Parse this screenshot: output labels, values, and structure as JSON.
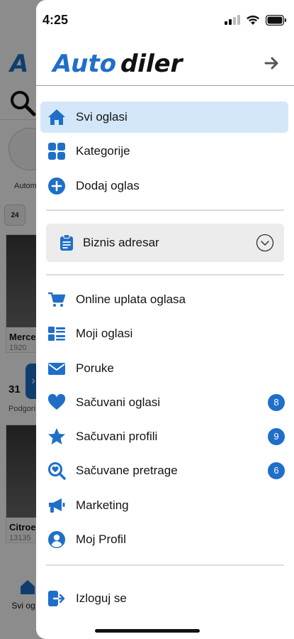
{
  "background": {
    "logo": "A",
    "category_label": "Autom",
    "badge_24": "24",
    "cards": [
      {
        "title": "Merce",
        "sub": "1920",
        "price": "31 ",
        "city": "Podgori"
      },
      {
        "title": "Citroe",
        "sub": "13135"
      }
    ],
    "tab_label": "Svi og"
  },
  "status_bar": {
    "time": "4:25"
  },
  "brand": {
    "logo_part1": "Auto",
    "logo_part2": "diler",
    "accent_color": "#1f6fc8"
  },
  "menu": {
    "primary": [
      {
        "label": "Svi oglasi",
        "icon": "home-icon",
        "active": true
      },
      {
        "label": "Kategorije",
        "icon": "grid-icon"
      },
      {
        "label": "Dodaj oglas",
        "icon": "plus-circle-icon"
      }
    ],
    "biznis_adresar": {
      "label": "Biznis adresar",
      "icon": "clipboard-icon"
    },
    "secondary": [
      {
        "label": "Online uplata oglasa",
        "icon": "cart-icon"
      },
      {
        "label": "Moji oglasi",
        "icon": "list-icon"
      },
      {
        "label": "Poruke",
        "icon": "envelope-icon"
      },
      {
        "label": "Sačuvani oglasi",
        "icon": "heart-icon",
        "badge": "8"
      },
      {
        "label": "Sačuvani profili",
        "icon": "star-icon",
        "badge": "9"
      },
      {
        "label": "Sačuvane pretrage",
        "icon": "search-heart-icon",
        "badge": "6"
      },
      {
        "label": "Marketing",
        "icon": "megaphone-icon"
      },
      {
        "label": "Moj Profil",
        "icon": "user-circle-icon"
      }
    ],
    "logout": {
      "label": "Izloguj se",
      "icon": "logout-icon"
    }
  }
}
